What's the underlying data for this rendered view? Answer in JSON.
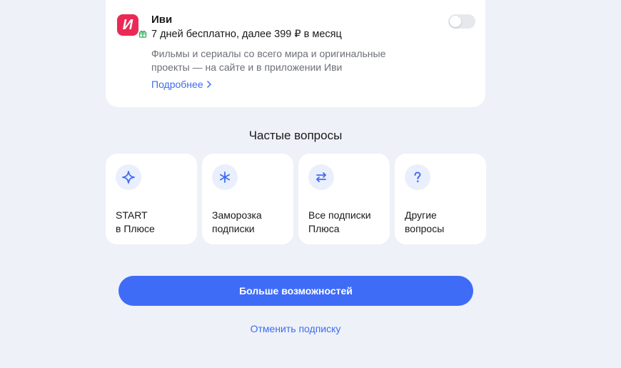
{
  "subscription": {
    "logo_letter": "И",
    "title": "Иви",
    "offer": "7 дней бесплатно, далее 399 ₽ в месяц",
    "description": "Фильмы и сериалы со всего мира и оригинальные проекты — на сайте и в приложении Иви",
    "more_link": "Подробнее",
    "toggle_on": false,
    "brand_color": "#ea2a55"
  },
  "faq": {
    "title": "Частые вопросы",
    "items": [
      {
        "label": "START\nв Плюсе",
        "icon": "sparkle-icon"
      },
      {
        "label": "Заморозка\nподписки",
        "icon": "snowflake-icon"
      },
      {
        "label": "Все подписки\nПлюса",
        "icon": "swap-arrows-icon"
      },
      {
        "label": "Другие\nвопросы",
        "icon": "question-icon"
      }
    ]
  },
  "actions": {
    "primary_label": "Больше возможностей",
    "cancel_label": "Отменить подписку"
  },
  "colors": {
    "accent": "#3f6cf6",
    "link": "#3d6cf0",
    "background": "#eef1f8"
  }
}
